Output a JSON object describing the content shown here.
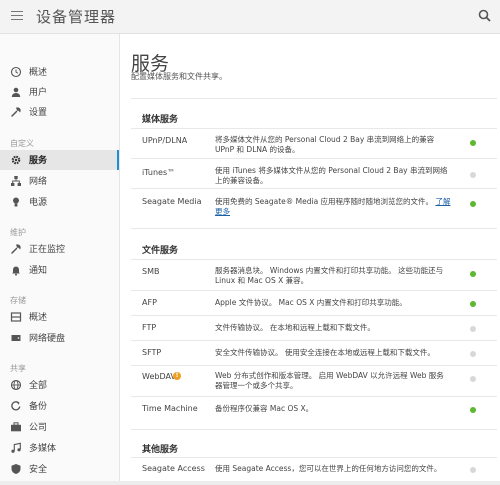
{
  "header": {
    "title": "设备管理器"
  },
  "colors": {
    "accent": "#1a8fd6",
    "status_on": "#5cb82e",
    "status_off": "#d8d8d8"
  },
  "sidebar": {
    "items": [
      {
        "label": "概述",
        "icon": "clock-icon"
      },
      {
        "label": "用户",
        "icon": "user-icon"
      },
      {
        "label": "设置",
        "icon": "wrench-icon"
      }
    ],
    "sections": [
      {
        "title": "自定义",
        "items": [
          {
            "label": "服务",
            "icon": "gear-icon",
            "active": true
          },
          {
            "label": "网络",
            "icon": "network-icon"
          },
          {
            "label": "电源",
            "icon": "bulb-icon"
          }
        ]
      },
      {
        "title": "维护",
        "items": [
          {
            "label": "正在监控",
            "icon": "wrench-icon"
          },
          {
            "label": "通知",
            "icon": "bell-icon"
          }
        ]
      },
      {
        "title": "存储",
        "items": [
          {
            "label": "概述",
            "icon": "storage-icon"
          },
          {
            "label": "网络硬盘",
            "icon": "drive-icon"
          }
        ]
      },
      {
        "title": "共享",
        "items": [
          {
            "label": "全部",
            "icon": "globe-icon"
          },
          {
            "label": "备份",
            "icon": "backup-icon"
          },
          {
            "label": "公司",
            "icon": "briefcase-icon"
          },
          {
            "label": "多媒体",
            "icon": "music-icon"
          },
          {
            "label": "安全",
            "icon": "shield-icon"
          }
        ]
      }
    ]
  },
  "main": {
    "title": "服务",
    "subtitle": "配置媒体服务和文件共享。",
    "groups": [
      {
        "title": "媒体服务",
        "services": [
          {
            "name": "UPnP/DLNA",
            "desc": "将多媒体文件从您的 Personal Cloud 2 Bay 串流到网络上的兼容 UPnP 和 DLNA 的设备。",
            "enabled": true
          },
          {
            "name": "iTunes™",
            "desc": "使用 iTunes 将多媒体文件从您的 Personal Cloud 2 Bay 串流到网络上的兼容设备。",
            "enabled": false
          },
          {
            "name": "Seagate Media",
            "desc": "使用免费的 Seagate® Media 应用程序随时随地浏览您的文件。",
            "link": "了解更多",
            "enabled": true
          }
        ]
      },
      {
        "title": "文件服务",
        "services": [
          {
            "name": "SMB",
            "desc": "服务器消息块。 Windows 内置文件和打印共享功能。 这些功能还与 Linux 和 Mac OS X 兼容。",
            "enabled": true
          },
          {
            "name": "AFP",
            "desc": "Apple 文件协议。 Mac OS X 内置文件和打印共享功能。",
            "enabled": true
          },
          {
            "name": "FTP",
            "desc": "文件传输协议。 在本地和远程上载和下载文件。",
            "enabled": false
          },
          {
            "name": "SFTP",
            "desc": "安全文件传输协议。 使用安全连接在本地或远程上载和下载文件。",
            "enabled": false
          },
          {
            "name": "WebDAV",
            "desc": "Web 分布式创作和版本管理。 启用 WebDAV 以允许远程 Web 服务器管理一个或多个共享。",
            "enabled": false,
            "warning": "!"
          },
          {
            "name": "Time Machine",
            "desc": "备份程序仅兼容 Mac OS X。",
            "enabled": true
          }
        ]
      },
      {
        "title": "其他服务",
        "services": [
          {
            "name": "Seagate Access",
            "desc": "使用 Seagate Access，您可以在世界上的任何地方访问您的文件。",
            "enabled": false
          }
        ]
      }
    ]
  }
}
